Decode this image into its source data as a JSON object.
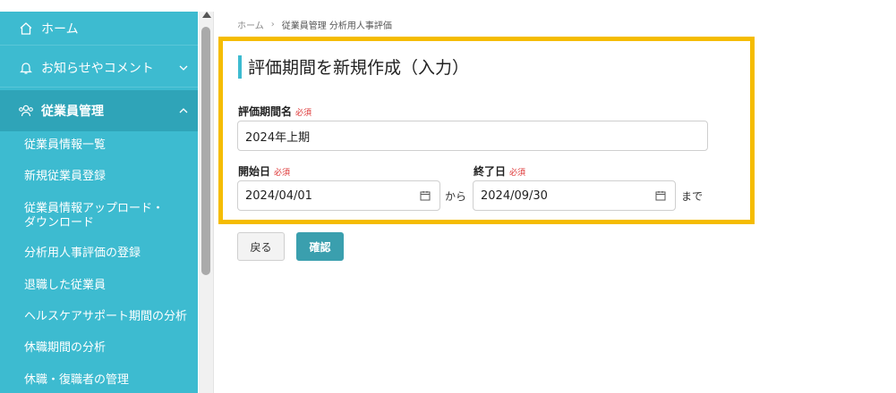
{
  "sidebar": {
    "home": "ホーム",
    "notice": "お知らせやコメント",
    "employee_mgmt": "従業員管理",
    "sub_items": [
      "従業員情報一覧",
      "新規従業員登録",
      "従業員情報アップロード・",
      "ダウンロード",
      "分析用人事評価の登録",
      "退職した従業員",
      "ヘルスケアサポート期間の分析",
      "休職期間の分析",
      "休職・復職者の管理"
    ]
  },
  "breadcrumb": {
    "home": "ホーム",
    "separator": "›",
    "current": "従業員管理 分析用人事評価"
  },
  "form": {
    "title": "評価期間を新規作成（入力）",
    "required": "必須",
    "period_name_label": "評価期間名",
    "period_name_value": "2024年上期",
    "start_label": "開始日",
    "start_value": "2024/04/01",
    "from_text": "から",
    "end_label": "終了日",
    "end_value": "2024/09/30",
    "until_text": "まで"
  },
  "buttons": {
    "back": "戻る",
    "confirm": "確認"
  },
  "colors": {
    "sidebar": "#3dbbd0",
    "sidebar_active": "#2fa4b8",
    "highlight": "#f5bc00",
    "primary_button": "#3a9fae",
    "required": "#dd3333"
  }
}
